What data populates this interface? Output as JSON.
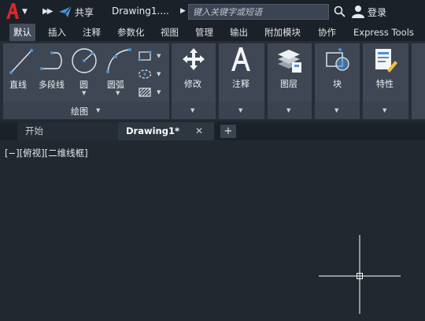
{
  "titlebar": {
    "share_label": "共享",
    "doc_title": "Drawing1....",
    "search_placeholder": "键入关键字或短语",
    "login_label": "登录"
  },
  "ribbon_tabs": [
    "默认",
    "插入",
    "注释",
    "参数化",
    "视图",
    "管理",
    "输出",
    "附加模块",
    "协作",
    "Express Tools"
  ],
  "active_tab": "默认",
  "draw_group": {
    "label": "绘图",
    "tools": [
      {
        "label": "直线",
        "icon": "line-icon"
      },
      {
        "label": "多段线",
        "icon": "polyline-icon"
      },
      {
        "label": "圆",
        "icon": "circle-icon"
      },
      {
        "label": "圆弧",
        "icon": "arc-icon"
      }
    ],
    "small_tools": [
      "rectangle-icon",
      "ellipse-icon",
      "hatch-icon"
    ]
  },
  "panels": [
    {
      "label": "修改",
      "icon": "move-icon"
    },
    {
      "label": "注释",
      "icon": "text-icon"
    },
    {
      "label": "图层",
      "icon": "layers-icon"
    },
    {
      "label": "块",
      "icon": "block-icon"
    },
    {
      "label": "特性",
      "icon": "properties-icon"
    }
  ],
  "doc_tabs": {
    "start": "开始",
    "drawing": "Drawing1*",
    "add": "+"
  },
  "canvas": {
    "viewport_label": "[−][俯视][二维线框]"
  },
  "colors": {
    "logo_red": "#d8262c",
    "accent_blue": "#4a90d9",
    "ribbon_panel": "#3e4753",
    "canvas_bg": "#212830"
  }
}
